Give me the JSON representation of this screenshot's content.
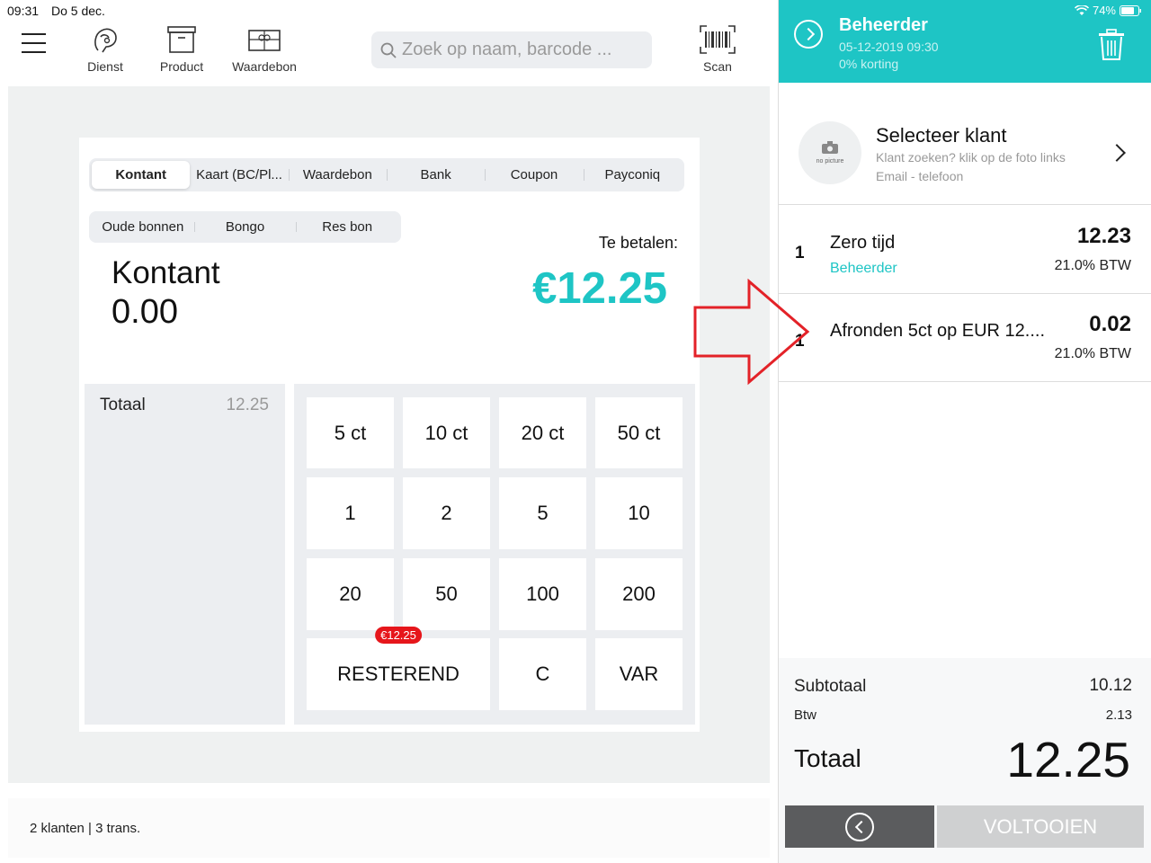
{
  "status": {
    "time": "09:31",
    "date": "Do 5 dec.",
    "battery": "74%"
  },
  "toolbar": {
    "tools": [
      {
        "label": "Dienst",
        "icon": "service-icon"
      },
      {
        "label": "Product",
        "icon": "product-box-icon"
      },
      {
        "label": "Waardebon",
        "icon": "voucher-icon"
      }
    ],
    "search_placeholder": "Zoek op naam, barcode ...",
    "scan_label": "Scan"
  },
  "payment": {
    "methods": [
      "Kontant",
      "Kaart (BC/Pl...",
      "Waardebon",
      "Bank",
      "Coupon",
      "Payconiq"
    ],
    "active_method": "Kontant",
    "extra_methods": [
      "Oude bonnen",
      "Bongo",
      "Res bon"
    ],
    "current_label": "Kontant",
    "current_amount": "0.00",
    "to_pay_label": "Te betalen:",
    "to_pay_amount": "€12.25",
    "total_label": "Totaal",
    "total_value": "12.25"
  },
  "keypad": {
    "row1": [
      "5 ct",
      "10 ct",
      "20 ct",
      "50 ct"
    ],
    "row2": [
      "1",
      "2",
      "5",
      "10"
    ],
    "row3": [
      "20",
      "50",
      "100",
      "200"
    ],
    "remaining_label": "RESTEREND",
    "remaining_badge": "€12.25",
    "clear_label": "C",
    "var_label": "VAR"
  },
  "footer": {
    "info": "2 klanten | 3 trans."
  },
  "cart": {
    "user": "Beheerder",
    "datetime": "05-12-2019 09:30",
    "discount": "0% korting",
    "customer": {
      "title": "Selecteer klant",
      "hint": "Klant zoeken? klik op de foto links",
      "contact": "Email - telefoon",
      "no_picture": "no picture"
    },
    "lines": [
      {
        "qty": "1",
        "name": "Zero tijd",
        "sub": "Beheerder",
        "price": "12.23",
        "vat": "21.0% BTW"
      },
      {
        "qty": "1",
        "name": "Afronden 5ct op EUR 12....",
        "sub": "",
        "price": "0.02",
        "vat": "21.0% BTW"
      }
    ],
    "subtotal_label": "Subtotaal",
    "subtotal_value": "10.12",
    "vat_label": "Btw",
    "vat_value": "2.13",
    "total_label": "Totaal",
    "total_value": "12.25",
    "complete_label": "VOLTOOIEN"
  },
  "colors": {
    "accent": "#1ec5c5",
    "badge": "#e6161b",
    "arrow": "#e32228"
  }
}
